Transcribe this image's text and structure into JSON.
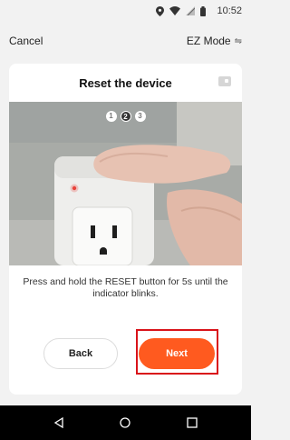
{
  "status_bar": {
    "time": "10:52"
  },
  "header": {
    "cancel_label": "Cancel",
    "mode_label": "EZ Mode",
    "mode_icon": "⇋"
  },
  "card": {
    "title": "Reset the device",
    "steps": [
      "1",
      "2",
      "3"
    ],
    "active_step": 2,
    "instruction": "Press and hold the RESET button for 5s until the indicator blinks.",
    "back_label": "Back",
    "next_label": "Next"
  },
  "colors": {
    "accent": "#ff5a1f",
    "highlight": "#d9131a"
  }
}
